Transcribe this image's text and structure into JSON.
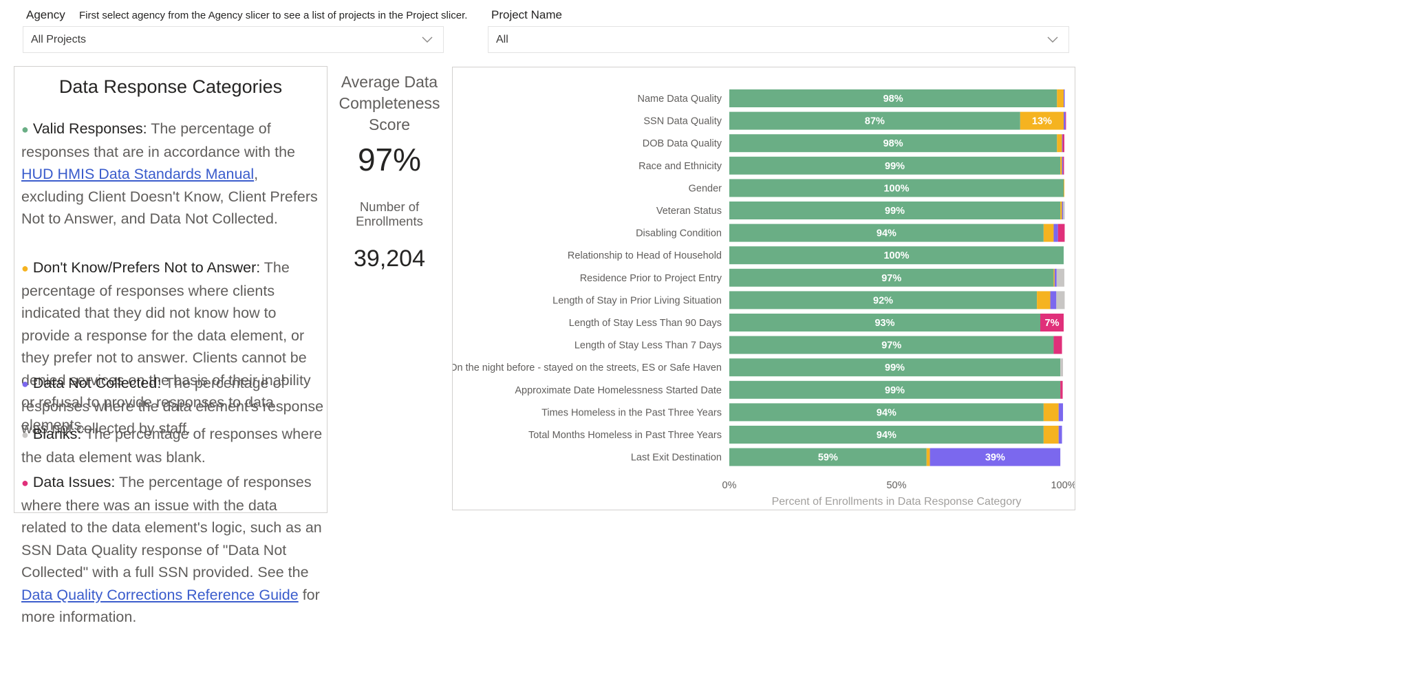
{
  "slicers": {
    "agency": {
      "title": "Agency",
      "note": "First select agency from the Agency slicer to see a list of projects in the Project slicer.",
      "value": "All Projects"
    },
    "project": {
      "title": "Project Name",
      "value": "All"
    }
  },
  "categories_panel": {
    "title": "Data Response Categories",
    "items": [
      {
        "name": "valid",
        "color": "#6aae85",
        "lead": "Valid Responses:",
        "text_before": " The percentage of responses that are in accordance with the ",
        "link": "HUD HMIS Data Standards Manual",
        "text_after": ", excluding Client Doesn't Know, Client Prefers Not to Answer, and Data Not Collected."
      },
      {
        "name": "dont-know",
        "color": "#f5b320",
        "lead": "Don't Know/Prefers Not to Answer:",
        "text_before": " The percentage of responses where clients indicated that they did not know how to provide a response for the data element, or they prefer not to answer. Clients cannot be denied services on the basis of their inability or refusal to provide responses to data elements.",
        "link": "",
        "text_after": ""
      },
      {
        "name": "not-collected",
        "color": "#7b68ee",
        "lead": "Data Not Collected:",
        "text_before": " The percentage of responses where the data element's response was not collected by staff.",
        "link": "",
        "text_after": ""
      },
      {
        "name": "blanks",
        "color": "#c8c6c4",
        "lead": "Blanks:",
        "text_before": " The percentage of responses where the data element was blank.",
        "link": "",
        "text_after": ""
      },
      {
        "name": "data-issues",
        "color": "#e0307a",
        "lead": "Data Issues:",
        "text_before": " The percentage of responses where there was an issue with the data related to the data element's logic, such as an SSN Data Quality response of \"Data Not Collected\" with a full SSN provided. See the",
        "link": " Data Quality Corrections Reference Guide",
        "text_after": " for more information."
      }
    ]
  },
  "kpi": {
    "score_label_1": "Average Data",
    "score_label_2": "Completeness",
    "score_label_3": "Score",
    "score_value": "97%",
    "enroll_label_1": "Number of",
    "enroll_label_2": "Enrollments",
    "enroll_value": "39,204"
  },
  "chart_data": {
    "type": "bar",
    "orientation": "horizontal",
    "stacked": true,
    "xlabel": "Percent of Enrollments in Data Response Category",
    "xlim": [
      0,
      100
    ],
    "xticks": [
      "0%",
      "50%",
      "100%"
    ],
    "grid": false,
    "colors": {
      "Valid Responses": "#6aae85",
      "Don't Know/Prefers Not to Answer": "#f5b320",
      "Data Not Collected": "#7b68ee",
      "Blanks": "#c8c6c4",
      "Data Issues": "#e0307a"
    },
    "categories": [
      "Name Data Quality",
      "SSN Data Quality",
      "DOB Data Quality",
      "Race and Ethnicity",
      "Gender",
      "Veteran Status",
      "Disabling Condition",
      "Relationship to Head of Household",
      "Residence Prior to Project Entry",
      "Length of Stay in Prior Living Situation",
      "Length of Stay Less Than 90 Days",
      "Length of Stay Less Than 7 Days",
      "On the night before - stayed on the streets, ES or Safe Haven",
      "Approximate Date Homelessness Started Date",
      "Times Homeless in the Past Three Years",
      "Total Months Homeless in Past Three Years",
      "Last Exit Destination"
    ],
    "series": [
      {
        "name": "Valid Responses",
        "values": [
          98,
          87,
          98,
          99,
          100,
          99,
          94,
          100,
          97,
          92,
          93,
          97,
          99,
          99,
          94,
          94,
          59
        ],
        "labels": [
          "98%",
          "87%",
          "98%",
          "99%",
          "100%",
          "99%",
          "94%",
          "100%",
          "97%",
          "92%",
          "93%",
          "97%",
          "99%",
          "99%",
          "94%",
          "94%",
          "59%"
        ]
      },
      {
        "name": "Don't Know/Prefers Not to Answer",
        "values": [
          2,
          13,
          1.5,
          0.5,
          0.2,
          0.5,
          3,
          0,
          0.3,
          4,
          0,
          0,
          0,
          0,
          4.5,
          4.5,
          1
        ],
        "labels": [
          "",
          "13%",
          "",
          "",
          "",
          "",
          "",
          "",
          "",
          "",
          "",
          "",
          "",
          "",
          "",
          "",
          ""
        ]
      },
      {
        "name": "Data Not Collected",
        "values": [
          0.3,
          0.5,
          0.2,
          0.3,
          0,
          0.3,
          1.3,
          0,
          0.6,
          1.8,
          0,
          0,
          0,
          0,
          1.3,
          1,
          39
        ],
        "labels": [
          "",
          "",
          "",
          "",
          "",
          "",
          "",
          "",
          "",
          "",
          "",
          "",
          "",
          "",
          "",
          "",
          "39%"
        ]
      },
      {
        "name": "Blanks",
        "values": [
          0,
          0,
          0,
          0,
          0,
          0.5,
          0,
          0,
          2.3,
          2.5,
          0,
          0,
          0.8,
          0,
          0,
          0,
          0
        ],
        "labels": [
          "",
          "",
          "",
          "",
          "",
          "",
          "",
          "",
          "",
          "",
          "",
          "",
          "",
          "",
          "",
          "",
          ""
        ]
      },
      {
        "name": "Data Issues",
        "values": [
          0,
          0.2,
          0.5,
          0.3,
          0,
          0,
          2,
          0,
          0,
          0,
          7,
          2.5,
          0,
          0.7,
          0,
          0,
          0
        ],
        "labels": [
          "",
          "",
          "",
          "",
          "",
          "",
          "",
          "",
          "",
          "",
          "7%",
          "",
          "",
          "",
          "",
          "",
          ""
        ]
      }
    ]
  }
}
